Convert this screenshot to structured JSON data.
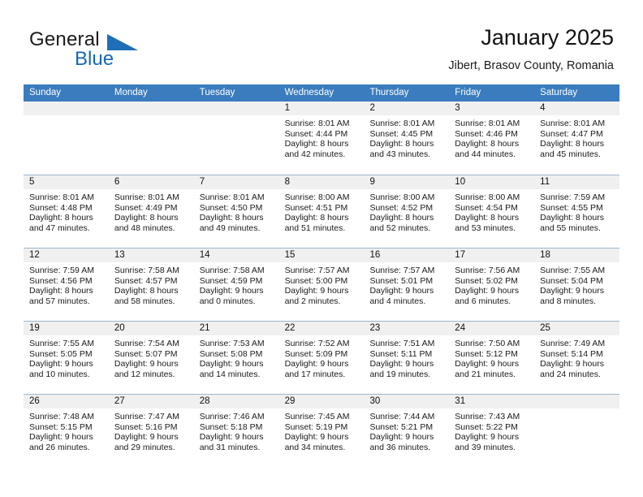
{
  "brand": {
    "word_one": "General",
    "word_two": "Blue",
    "triangle_icon": "triangle-icon"
  },
  "header": {
    "title": "January 2025",
    "subtitle": "Jibert, Brasov County, Romania"
  },
  "colors": {
    "header_bar": "#3a7cbe",
    "brand_blue": "#1668b4",
    "day_number_band": "#f0f0f0",
    "week_separator": "#9fb6cd"
  },
  "weekdays": [
    "Sunday",
    "Monday",
    "Tuesday",
    "Wednesday",
    "Thursday",
    "Friday",
    "Saturday"
  ],
  "labels": {
    "sunrise_prefix": "Sunrise:",
    "sunset_prefix": "Sunset:",
    "daylight_prefix": "Daylight:"
  },
  "weeks": [
    [
      {
        "day": "",
        "empty": true,
        "sunrise": "",
        "sunset": "",
        "daylight1": "",
        "daylight2": ""
      },
      {
        "day": "",
        "empty": true,
        "sunrise": "",
        "sunset": "",
        "daylight1": "",
        "daylight2": ""
      },
      {
        "day": "",
        "empty": true,
        "sunrise": "",
        "sunset": "",
        "daylight1": "",
        "daylight2": ""
      },
      {
        "day": "1",
        "empty": false,
        "sunrise": "Sunrise: 8:01 AM",
        "sunset": "Sunset: 4:44 PM",
        "daylight1": "Daylight: 8 hours",
        "daylight2": "and 42 minutes."
      },
      {
        "day": "2",
        "empty": false,
        "sunrise": "Sunrise: 8:01 AM",
        "sunset": "Sunset: 4:45 PM",
        "daylight1": "Daylight: 8 hours",
        "daylight2": "and 43 minutes."
      },
      {
        "day": "3",
        "empty": false,
        "sunrise": "Sunrise: 8:01 AM",
        "sunset": "Sunset: 4:46 PM",
        "daylight1": "Daylight: 8 hours",
        "daylight2": "and 44 minutes."
      },
      {
        "day": "4",
        "empty": false,
        "sunrise": "Sunrise: 8:01 AM",
        "sunset": "Sunset: 4:47 PM",
        "daylight1": "Daylight: 8 hours",
        "daylight2": "and 45 minutes."
      }
    ],
    [
      {
        "day": "5",
        "empty": false,
        "sunrise": "Sunrise: 8:01 AM",
        "sunset": "Sunset: 4:48 PM",
        "daylight1": "Daylight: 8 hours",
        "daylight2": "and 47 minutes."
      },
      {
        "day": "6",
        "empty": false,
        "sunrise": "Sunrise: 8:01 AM",
        "sunset": "Sunset: 4:49 PM",
        "daylight1": "Daylight: 8 hours",
        "daylight2": "and 48 minutes."
      },
      {
        "day": "7",
        "empty": false,
        "sunrise": "Sunrise: 8:01 AM",
        "sunset": "Sunset: 4:50 PM",
        "daylight1": "Daylight: 8 hours",
        "daylight2": "and 49 minutes."
      },
      {
        "day": "8",
        "empty": false,
        "sunrise": "Sunrise: 8:00 AM",
        "sunset": "Sunset: 4:51 PM",
        "daylight1": "Daylight: 8 hours",
        "daylight2": "and 51 minutes."
      },
      {
        "day": "9",
        "empty": false,
        "sunrise": "Sunrise: 8:00 AM",
        "sunset": "Sunset: 4:52 PM",
        "daylight1": "Daylight: 8 hours",
        "daylight2": "and 52 minutes."
      },
      {
        "day": "10",
        "empty": false,
        "sunrise": "Sunrise: 8:00 AM",
        "sunset": "Sunset: 4:54 PM",
        "daylight1": "Daylight: 8 hours",
        "daylight2": "and 53 minutes."
      },
      {
        "day": "11",
        "empty": false,
        "sunrise": "Sunrise: 7:59 AM",
        "sunset": "Sunset: 4:55 PM",
        "daylight1": "Daylight: 8 hours",
        "daylight2": "and 55 minutes."
      }
    ],
    [
      {
        "day": "12",
        "empty": false,
        "sunrise": "Sunrise: 7:59 AM",
        "sunset": "Sunset: 4:56 PM",
        "daylight1": "Daylight: 8 hours",
        "daylight2": "and 57 minutes."
      },
      {
        "day": "13",
        "empty": false,
        "sunrise": "Sunrise: 7:58 AM",
        "sunset": "Sunset: 4:57 PM",
        "daylight1": "Daylight: 8 hours",
        "daylight2": "and 58 minutes."
      },
      {
        "day": "14",
        "empty": false,
        "sunrise": "Sunrise: 7:58 AM",
        "sunset": "Sunset: 4:59 PM",
        "daylight1": "Daylight: 9 hours",
        "daylight2": "and 0 minutes."
      },
      {
        "day": "15",
        "empty": false,
        "sunrise": "Sunrise: 7:57 AM",
        "sunset": "Sunset: 5:00 PM",
        "daylight1": "Daylight: 9 hours",
        "daylight2": "and 2 minutes."
      },
      {
        "day": "16",
        "empty": false,
        "sunrise": "Sunrise: 7:57 AM",
        "sunset": "Sunset: 5:01 PM",
        "daylight1": "Daylight: 9 hours",
        "daylight2": "and 4 minutes."
      },
      {
        "day": "17",
        "empty": false,
        "sunrise": "Sunrise: 7:56 AM",
        "sunset": "Sunset: 5:02 PM",
        "daylight1": "Daylight: 9 hours",
        "daylight2": "and 6 minutes."
      },
      {
        "day": "18",
        "empty": false,
        "sunrise": "Sunrise: 7:55 AM",
        "sunset": "Sunset: 5:04 PM",
        "daylight1": "Daylight: 9 hours",
        "daylight2": "and 8 minutes."
      }
    ],
    [
      {
        "day": "19",
        "empty": false,
        "sunrise": "Sunrise: 7:55 AM",
        "sunset": "Sunset: 5:05 PM",
        "daylight1": "Daylight: 9 hours",
        "daylight2": "and 10 minutes."
      },
      {
        "day": "20",
        "empty": false,
        "sunrise": "Sunrise: 7:54 AM",
        "sunset": "Sunset: 5:07 PM",
        "daylight1": "Daylight: 9 hours",
        "daylight2": "and 12 minutes."
      },
      {
        "day": "21",
        "empty": false,
        "sunrise": "Sunrise: 7:53 AM",
        "sunset": "Sunset: 5:08 PM",
        "daylight1": "Daylight: 9 hours",
        "daylight2": "and 14 minutes."
      },
      {
        "day": "22",
        "empty": false,
        "sunrise": "Sunrise: 7:52 AM",
        "sunset": "Sunset: 5:09 PM",
        "daylight1": "Daylight: 9 hours",
        "daylight2": "and 17 minutes."
      },
      {
        "day": "23",
        "empty": false,
        "sunrise": "Sunrise: 7:51 AM",
        "sunset": "Sunset: 5:11 PM",
        "daylight1": "Daylight: 9 hours",
        "daylight2": "and 19 minutes."
      },
      {
        "day": "24",
        "empty": false,
        "sunrise": "Sunrise: 7:50 AM",
        "sunset": "Sunset: 5:12 PM",
        "daylight1": "Daylight: 9 hours",
        "daylight2": "and 21 minutes."
      },
      {
        "day": "25",
        "empty": false,
        "sunrise": "Sunrise: 7:49 AM",
        "sunset": "Sunset: 5:14 PM",
        "daylight1": "Daylight: 9 hours",
        "daylight2": "and 24 minutes."
      }
    ],
    [
      {
        "day": "26",
        "empty": false,
        "sunrise": "Sunrise: 7:48 AM",
        "sunset": "Sunset: 5:15 PM",
        "daylight1": "Daylight: 9 hours",
        "daylight2": "and 26 minutes."
      },
      {
        "day": "27",
        "empty": false,
        "sunrise": "Sunrise: 7:47 AM",
        "sunset": "Sunset: 5:16 PM",
        "daylight1": "Daylight: 9 hours",
        "daylight2": "and 29 minutes."
      },
      {
        "day": "28",
        "empty": false,
        "sunrise": "Sunrise: 7:46 AM",
        "sunset": "Sunset: 5:18 PM",
        "daylight1": "Daylight: 9 hours",
        "daylight2": "and 31 minutes."
      },
      {
        "day": "29",
        "empty": false,
        "sunrise": "Sunrise: 7:45 AM",
        "sunset": "Sunset: 5:19 PM",
        "daylight1": "Daylight: 9 hours",
        "daylight2": "and 34 minutes."
      },
      {
        "day": "30",
        "empty": false,
        "sunrise": "Sunrise: 7:44 AM",
        "sunset": "Sunset: 5:21 PM",
        "daylight1": "Daylight: 9 hours",
        "daylight2": "and 36 minutes."
      },
      {
        "day": "31",
        "empty": false,
        "sunrise": "Sunrise: 7:43 AM",
        "sunset": "Sunset: 5:22 PM",
        "daylight1": "Daylight: 9 hours",
        "daylight2": "and 39 minutes."
      },
      {
        "day": "",
        "empty": true,
        "sunrise": "",
        "sunset": "",
        "daylight1": "",
        "daylight2": ""
      }
    ]
  ]
}
